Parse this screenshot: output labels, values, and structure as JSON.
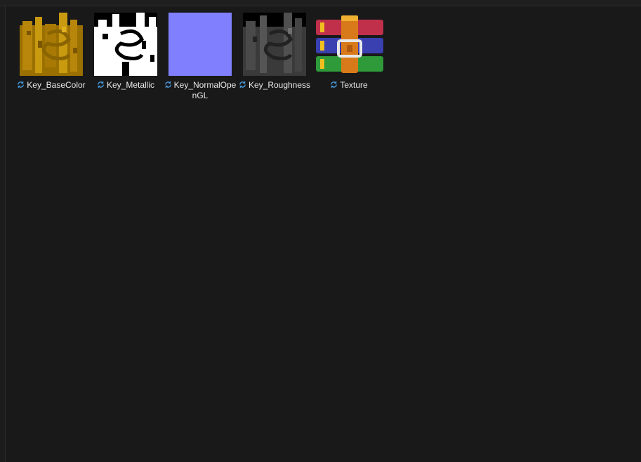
{
  "files": [
    {
      "name": "Key_BaseColor",
      "icon": "texture-basecolor-thumbnail",
      "sync": "sync-icon"
    },
    {
      "name": "Key_Metallic",
      "icon": "texture-metallic-thumbnail",
      "sync": "sync-icon"
    },
    {
      "name": "Key_NormalOpenGL",
      "icon": "texture-normal-thumbnail",
      "sync": "sync-icon"
    },
    {
      "name": "Key_Roughness",
      "icon": "texture-roughness-thumbnail",
      "sync": "sync-icon"
    },
    {
      "name": "Texture",
      "icon": "winrar-archive-icon",
      "sync": "sync-icon"
    }
  ],
  "colors": {
    "background": "#191919",
    "text": "#e8e8e8",
    "sync_blue": "#4a9de0",
    "basecolor": "#b8860b",
    "normal": "#8080ff"
  }
}
